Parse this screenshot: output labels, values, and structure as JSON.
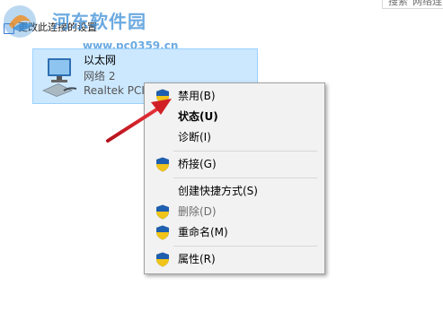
{
  "header": {
    "search_placeholder": "搜索\"网络连"
  },
  "command_bar": {
    "label": "更改此连接的设置"
  },
  "watermark": {
    "title": "河东软件园",
    "url": "www.pc0359.cn"
  },
  "adapter": {
    "name": "以太网",
    "network": "网络  2",
    "device": "Realtek PCIe"
  },
  "context_menu": {
    "items": [
      {
        "label": "禁用(B)",
        "shield": true,
        "bold": false,
        "disabled": false
      },
      {
        "label": "状态(U)",
        "shield": false,
        "bold": true,
        "disabled": false
      },
      {
        "label": "诊断(I)",
        "shield": false,
        "bold": false,
        "disabled": false
      },
      {
        "label": "桥接(G)",
        "shield": true,
        "bold": false,
        "disabled": false
      },
      {
        "label": "创建快捷方式(S)",
        "shield": false,
        "bold": false,
        "disabled": false
      },
      {
        "label": "删除(D)",
        "shield": true,
        "bold": false,
        "disabled": true
      },
      {
        "label": "重命名(M)",
        "shield": true,
        "bold": false,
        "disabled": false
      },
      {
        "label": "属性(R)",
        "shield": true,
        "bold": false,
        "disabled": false
      }
    ]
  },
  "colors": {
    "selection_bg": "#cce8ff",
    "menu_bg": "#f2f2f2",
    "arrow": "#d21f26",
    "watermark": "#3c8ed8"
  },
  "icons": {
    "shield": "uac-shield-icon",
    "adapter": "network-adapter-icon",
    "arrow": "red-pointer-arrow"
  }
}
